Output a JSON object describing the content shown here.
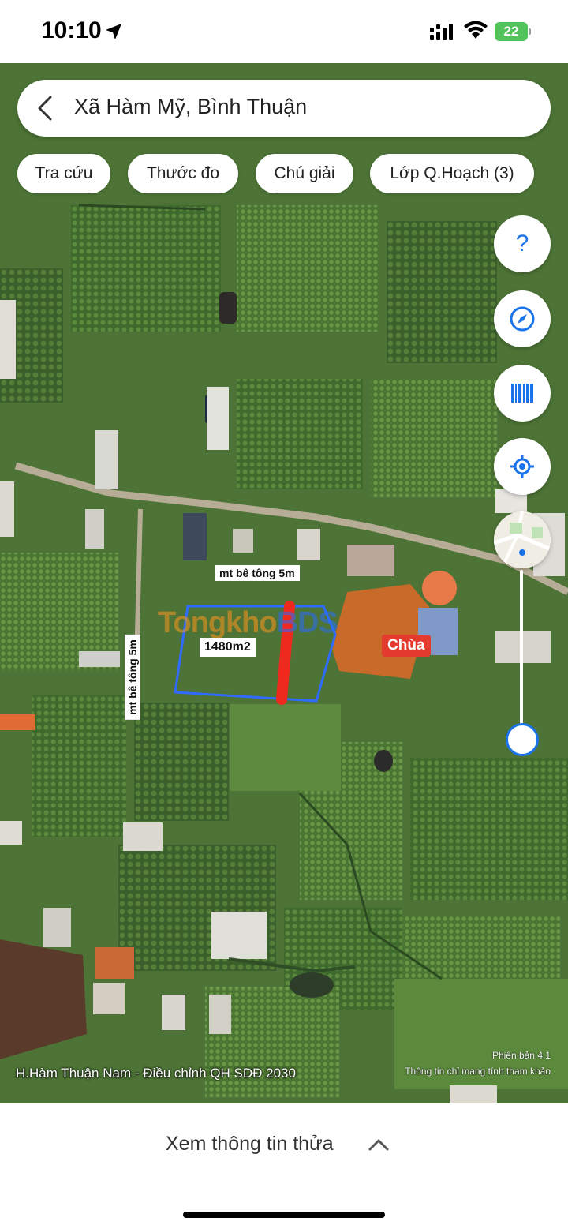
{
  "status_bar": {
    "time": "10:10",
    "battery": "22"
  },
  "search": {
    "location": "Xã Hàm Mỹ, Bình Thuận"
  },
  "toolbar": {
    "chips": [
      "Tra cứu",
      "Thước đo",
      "Chú giải",
      "Lớp Q.Hoạch (3)"
    ]
  },
  "map": {
    "road_label_1": "mt bê tông 5m",
    "road_label_2": "mt bê tông 5m",
    "parcel_area": "1480m2",
    "temple_label": "Chùa",
    "watermark_part1": "Tongkho",
    "watermark_part2": "BDS",
    "caption": "H.Hàm Thuận Nam - Điều chỉnh QH SDĐ 2030",
    "version": "Phiên bản 4.1",
    "disclaimer": "Thông tin chỉ mang tính tham khảo",
    "colors": {
      "parcel_outline": "#2f6bff",
      "marker_line": "#ee2a1f",
      "temple_badge": "#e43b2f",
      "accent": "#1a73e8"
    }
  },
  "controls": {
    "help_glyph": "?",
    "icons": [
      "help-icon",
      "compass-icon",
      "barcode-icon",
      "locate-icon",
      "map-layer-icon"
    ]
  },
  "bottom_sheet": {
    "label": "Xem thông tin thửa"
  }
}
